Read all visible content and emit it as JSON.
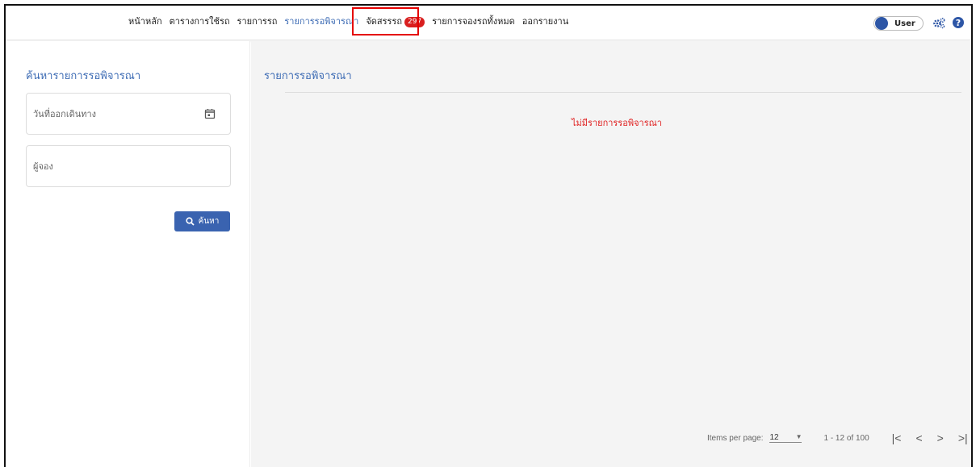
{
  "nav": {
    "items": [
      {
        "label": "หน้าหลัก"
      },
      {
        "label": "ตารางการใช้รถ"
      },
      {
        "label": "รายการรถ"
      },
      {
        "label": "รายการรอพิจารณา"
      },
      {
        "label": "จัดสรรรถ",
        "badge": "297"
      },
      {
        "label": "รายการจองรถทั้งหมด"
      },
      {
        "label": "ออกรายงาน"
      }
    ],
    "active_index": 3,
    "highlighted_index": 4
  },
  "toolbar": {
    "user_toggle_label": "User",
    "icons": [
      "gears-icon",
      "help-icon"
    ]
  },
  "sidebar": {
    "title": "ค้นหารายการรอพิจารณา",
    "date_field": {
      "placeholder": "วันที่ออกเดินทาง",
      "value": "",
      "icon": "calendar-icon"
    },
    "booker_field": {
      "placeholder": "ผู้จอง",
      "value": ""
    },
    "search_button": "ค้นหา"
  },
  "main": {
    "title": "รายการรอพิจารณา",
    "empty_message": "ไม่มีรายการรอพิจารณา"
  },
  "paginator": {
    "items_per_page_label": "Items per page:",
    "items_per_page": "12",
    "range_label": "1 - 12 of 100"
  },
  "colors": {
    "accent": "#3f6db5",
    "button": "#3a63b0",
    "badge": "#d91e1e",
    "highlight_box": "#e50000",
    "empty_message": "#e02020"
  }
}
